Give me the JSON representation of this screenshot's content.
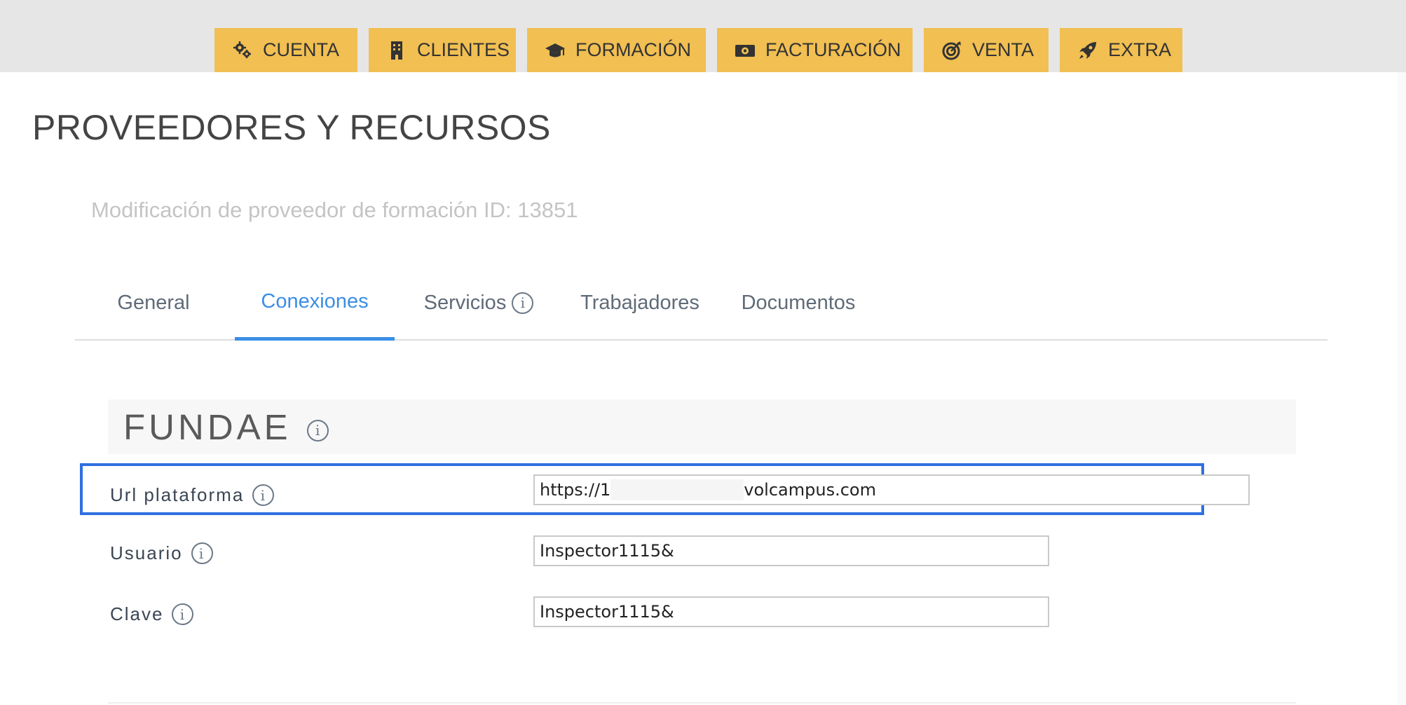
{
  "nav": {
    "items": [
      {
        "label": "CUENTA",
        "icon": "gears-icon"
      },
      {
        "label": "CLIENTES",
        "icon": "building-icon"
      },
      {
        "label": "FORMACIÓN",
        "icon": "graduation-cap-icon"
      },
      {
        "label": "FACTURACIÓN",
        "icon": "money-bill-icon"
      },
      {
        "label": "VENTA",
        "icon": "bullseye-icon"
      },
      {
        "label": "EXTRA",
        "icon": "rocket-icon"
      }
    ],
    "color": "#f1bf52"
  },
  "page": {
    "title": "PROVEEDORES Y RECURSOS",
    "subtitle": "Modificación de proveedor de formación ID: 13851"
  },
  "tabs": {
    "items": [
      "General",
      "Conexiones",
      "Servicios",
      "Trabajadores",
      "Documentos"
    ],
    "active": "Conexiones",
    "accent": "#3a8ee6"
  },
  "section": {
    "title": "FUNDAE"
  },
  "form": {
    "url_label": "Url plataforma",
    "url_value_prefix": "https://1",
    "url_value_suffix": "volcampus.com",
    "user_label": "Usuario",
    "user_value": "Inspector1115&",
    "password_label": "Clave",
    "password_value": "Inspector1115&"
  },
  "highlight_color": "#2f6fe0",
  "info_glyph": "i"
}
